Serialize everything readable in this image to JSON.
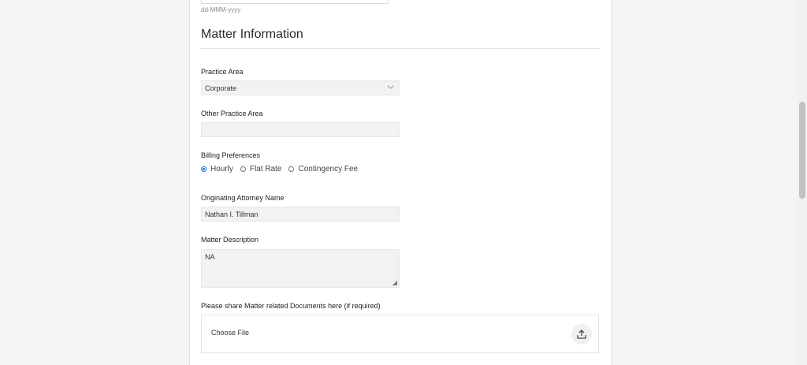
{
  "date_hint": "dd-MMM-yyyy",
  "section_title": "Matter Information",
  "practice_area": {
    "label": "Practice Area",
    "value": "Corporate"
  },
  "other_practice_area": {
    "label": "Other Practice Area",
    "value": ""
  },
  "billing": {
    "label": "Billing Preferences",
    "options": [
      "Hourly",
      "Flat Rate",
      "Contingency Fee"
    ],
    "selected": "Hourly"
  },
  "originating_attorney": {
    "label": "Originating Attorney Name",
    "value": "Nathan I. Tillman"
  },
  "matter_description": {
    "label": "Matter Description",
    "value": "NA"
  },
  "documents": {
    "label": "Please share Matter related Documents here (if required)",
    "choose_file": "Choose File"
  },
  "icons": {
    "select": "chevron-down-icon",
    "upload": "upload-icon"
  }
}
